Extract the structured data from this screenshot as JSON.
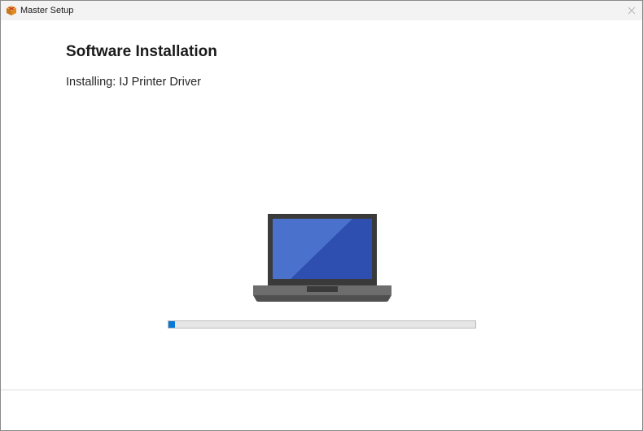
{
  "window": {
    "title": "Master Setup",
    "app_icon": "package-box-icon",
    "close_icon": "close-icon"
  },
  "main": {
    "heading": "Software Installation",
    "status": "Installing: IJ Printer Driver",
    "illustration": "laptop-icon",
    "progress": {
      "percent": 2,
      "fill_color": "#0a78d7"
    }
  },
  "colors": {
    "accent": "#0a78d7",
    "laptop_screen": "#2f5bc4",
    "laptop_body": "#3a3a3a"
  }
}
